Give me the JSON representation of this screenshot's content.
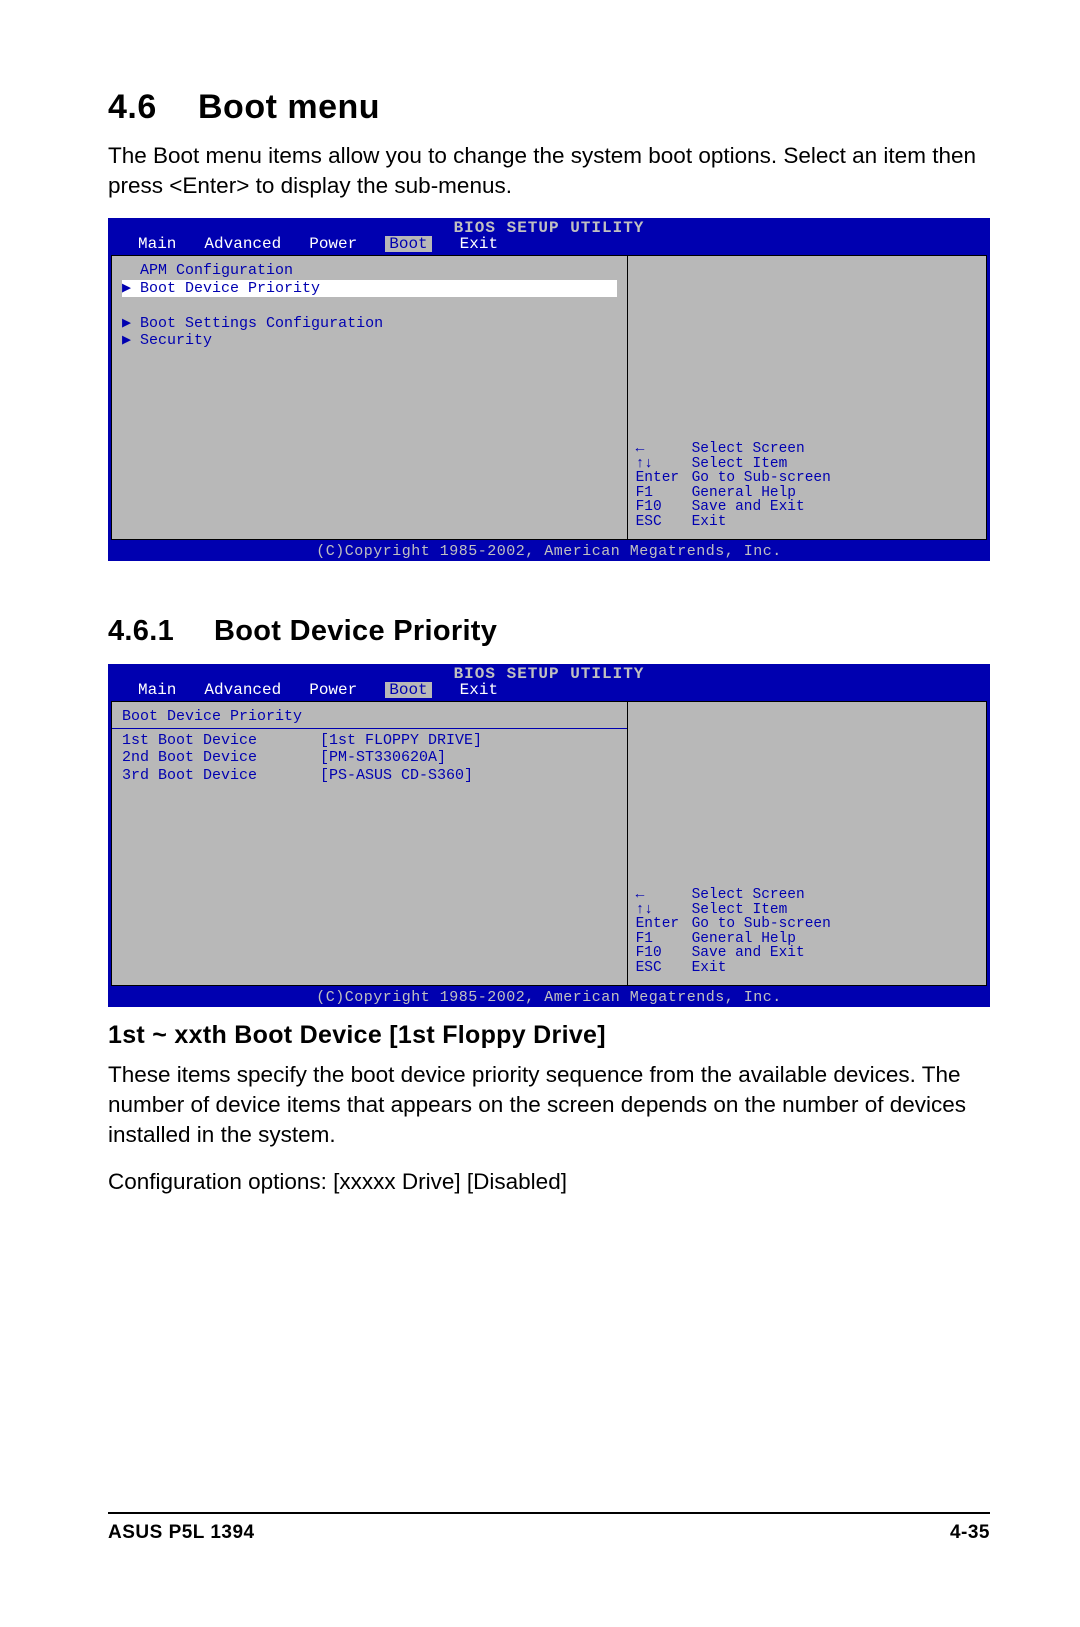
{
  "heading": {
    "num": "4.6",
    "title": "Boot menu"
  },
  "intro": "The Boot menu items allow you to change the system boot options. Select an item then press <Enter> to display the sub-menus.",
  "bios_common": {
    "title": "BIOS SETUP UTILITY",
    "tabs": [
      "Main",
      "Advanced",
      "Power",
      "Boot",
      "Exit"
    ],
    "active_tab": "Boot",
    "help": [
      {
        "key_icon": "arrow-left",
        "key": "",
        "desc": "Select Screen"
      },
      {
        "key_icon": "arrow-ud",
        "key": "",
        "desc": "Select Item"
      },
      {
        "key_icon": "",
        "key": "Enter",
        "desc": "Go to Sub-screen"
      },
      {
        "key_icon": "",
        "key": "F1",
        "desc": "General Help"
      },
      {
        "key_icon": "",
        "key": "F10",
        "desc": "Save and Exit"
      },
      {
        "key_icon": "",
        "key": "ESC",
        "desc": "Exit"
      }
    ],
    "copyright": "(C)Copyright 1985-2002, American Megatrends, Inc."
  },
  "bios1": {
    "items": [
      {
        "arrow": false,
        "label": "APM Configuration",
        "selected": false
      },
      {
        "arrow": true,
        "label": "Boot Device Priority",
        "selected": true
      },
      {
        "arrow": false,
        "label": "",
        "selected": false
      },
      {
        "arrow": true,
        "label": "Boot Settings Configuration",
        "selected": false
      },
      {
        "arrow": true,
        "label": "Security",
        "selected": false
      }
    ]
  },
  "sub_heading": {
    "num": "4.6.1",
    "title": "Boot Device Priority"
  },
  "bios2": {
    "header": "Boot Device Priority",
    "rows": [
      {
        "label": "1st Boot Device",
        "value": "[1st FLOPPY DRIVE]"
      },
      {
        "label": "2nd Boot Device",
        "value": "[PM-ST330620A]"
      },
      {
        "label": "3rd Boot Device",
        "value": "[PS-ASUS CD-S360]"
      }
    ]
  },
  "sub_h3": "1st ~ xxth Boot Device [1st Floppy Drive]",
  "body2a": "These items specify the boot device priority sequence from the available devices. The number of device items that appears on the screen depends on the number of devices installed in the system.",
  "body2b": "Configuration options: [xxxxx Drive] [Disabled]",
  "footer": {
    "left": "ASUS P5L 1394",
    "right": "4-35"
  }
}
